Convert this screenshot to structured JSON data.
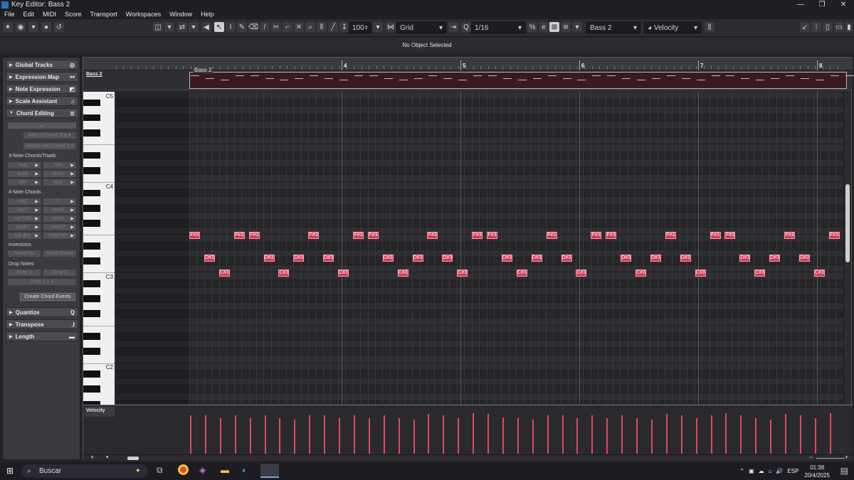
{
  "window": {
    "title": "Key Editor: Bass 2",
    "buttons": [
      "—",
      "❐",
      "✕"
    ]
  },
  "menu": [
    "File",
    "Edit",
    "MIDI",
    "Score",
    "Transport",
    "Workspaces",
    "Window",
    "Help"
  ],
  "toolbar": {
    "velocity_value": "100",
    "snap_mode": "Grid",
    "quantize": "1/16",
    "track_select": "Bass 2",
    "controller": "Velocity"
  },
  "info_line": "No Object Selected",
  "inspector": {
    "sections": [
      {
        "label": "Global Tracks",
        "icon": "◎",
        "expanded": false
      },
      {
        "label": "Expression Map",
        "icon": "⚯",
        "expanded": false
      },
      {
        "label": "Note Expression",
        "icon": "◩",
        "expanded": false
      },
      {
        "label": "Scale Assistant",
        "icon": "♫",
        "expanded": false
      },
      {
        "label": "Chord Editing",
        "icon": "≣",
        "expanded": true
      }
    ],
    "chord_field": "...",
    "add_to_chord_track": "Add to Chord Track",
    "match_with_chord": "Match with Chord Tra",
    "triads_label": "3-Note Chords/Triads",
    "triads": [
      "maj",
      "min",
      "sus4",
      "sus2",
      "dim",
      "aug"
    ],
    "four_label": "4-Note Chords",
    "four_chords": [
      "maj7",
      "7",
      "min7",
      "min6",
      "min7/b5",
      "min9",
      "sus4/7",
      "sus2/7",
      "full dim",
      "maj7/#5"
    ],
    "inversions_label": "Inversions",
    "inversions": [
      "Move Up",
      "Move Down"
    ],
    "drop_label": "Drop Notes",
    "drops": [
      "Drop 2",
      "Drop 3",
      "Drop 2 + 4"
    ],
    "create_chord": "Create Chord Events",
    "bottom_sections": [
      {
        "label": "Quantize",
        "icon": "Q"
      },
      {
        "label": "Transpose",
        "icon": "⅃"
      },
      {
        "label": "Length",
        "icon": "▬"
      }
    ]
  },
  "editor": {
    "part_name": "Bass 2",
    "track_name": "Bass 2",
    "bars": [
      "4",
      "5",
      "6",
      "7",
      "8"
    ],
    "key_labels": [
      "C5",
      "C4",
      "C3",
      "C2"
    ],
    "velocity_label": "Velocity",
    "note_names": [
      "F#3",
      "D#3",
      "C#3"
    ],
    "notes": [
      {
        "p": "F#3",
        "b": 0
      },
      {
        "p": "D#3",
        "b": 1
      },
      {
        "p": "C#3",
        "b": 2
      },
      {
        "p": "F#3",
        "b": 3
      },
      {
        "p": "F#3",
        "b": 4
      },
      {
        "p": "D#3",
        "b": 5
      },
      {
        "p": "C#3",
        "b": 6
      },
      {
        "p": "D#3",
        "b": 7
      },
      {
        "p": "F#3",
        "b": 8
      },
      {
        "p": "D#3",
        "b": 9
      },
      {
        "p": "C#3",
        "b": 10
      },
      {
        "p": "F#3",
        "b": 11
      },
      {
        "p": "F#3",
        "b": 12
      },
      {
        "p": "D#3",
        "b": 13
      },
      {
        "p": "C#3",
        "b": 14
      },
      {
        "p": "D#3",
        "b": 15
      },
      {
        "p": "F#3",
        "b": 16
      },
      {
        "p": "D#3",
        "b": 17
      },
      {
        "p": "C#3",
        "b": 18
      },
      {
        "p": "F#3",
        "b": 19
      },
      {
        "p": "F#3",
        "b": 20
      },
      {
        "p": "D#3",
        "b": 21
      },
      {
        "p": "C#3",
        "b": 22
      },
      {
        "p": "D#3",
        "b": 23
      },
      {
        "p": "F#3",
        "b": 24
      },
      {
        "p": "D#3",
        "b": 25
      },
      {
        "p": "C#3",
        "b": 26
      },
      {
        "p": "F#3",
        "b": 27
      },
      {
        "p": "F#3",
        "b": 28
      },
      {
        "p": "D#3",
        "b": 29
      },
      {
        "p": "C#3",
        "b": 30
      },
      {
        "p": "D#3",
        "b": 31
      },
      {
        "p": "F#3",
        "b": 32
      },
      {
        "p": "D#3",
        "b": 33
      },
      {
        "p": "C#3",
        "b": 34
      },
      {
        "p": "F#3",
        "b": 35
      },
      {
        "p": "F#3",
        "b": 36
      },
      {
        "p": "D#3",
        "b": 37
      },
      {
        "p": "C#3",
        "b": 38
      },
      {
        "p": "D#3",
        "b": 39
      },
      {
        "p": "F#3",
        "b": 40
      },
      {
        "p": "D#3",
        "b": 41
      },
      {
        "p": "C#3",
        "b": 42
      },
      {
        "p": "F#3",
        "b": 43
      },
      {
        "p": "F#3",
        "b": 44
      }
    ],
    "velocities": [
      0.82,
      0.82,
      0.75,
      0.82,
      0.75,
      0.82,
      0.75,
      0.72,
      0.82,
      0.82,
      0.75,
      0.82,
      0.75,
      0.82,
      0.75,
      0.72,
      0.85,
      0.82,
      0.75,
      0.86,
      0.85,
      0.78,
      0.75,
      0.72,
      0.82,
      0.82,
      0.75,
      0.82,
      0.75,
      0.82,
      0.75,
      0.72,
      0.85,
      0.82,
      0.75,
      0.82,
      0.86,
      0.82,
      0.75,
      0.72,
      0.85,
      0.82,
      0.75,
      0.87,
      0.82
    ],
    "accent_color": "#d23a55"
  },
  "taskbar": {
    "search_placeholder": "Buscar",
    "lang": "ESP",
    "time": "01:38",
    "date": "20/4/2025"
  }
}
